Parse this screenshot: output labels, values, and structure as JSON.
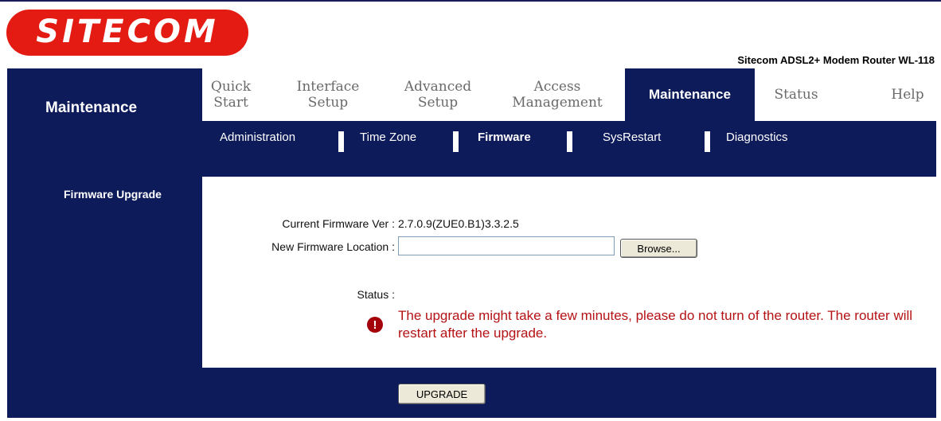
{
  "brand": {
    "logo_text": "SITECOM",
    "model": "Sitecom ADSL2+ Modem Router WL-118",
    "logo_color": "#e41b12"
  },
  "colors": {
    "navy": "#0e1b5a",
    "warning": "#b41214"
  },
  "section": {
    "title": "Maintenance",
    "sub_title": "Firmware Upgrade"
  },
  "tabs": [
    {
      "label": "Quick\nStart"
    },
    {
      "label": "Interface\nSetup"
    },
    {
      "label": "Advanced\nSetup"
    },
    {
      "label": "Access\nManagement"
    },
    {
      "label": "Maintenance",
      "active": true
    },
    {
      "label": "Status"
    },
    {
      "label": "Help"
    }
  ],
  "subtabs": [
    {
      "label": "Administration"
    },
    {
      "label": "Time Zone"
    },
    {
      "label": "Firmware",
      "active": true
    },
    {
      "label": "SysRestart"
    },
    {
      "label": "Diagnostics"
    }
  ],
  "firmware": {
    "current_label": "Current Firmware Ver :",
    "current_value": "2.7.0.9(ZUE0.B1)3.3.2.5",
    "location_label": "New Firmware Location :",
    "location_value": "",
    "browse_label": "Browse...",
    "status_label": "Status :",
    "warning_icon": "exclamation-icon",
    "warning_text": "The upgrade might take a few minutes, please do not turn of the router. The router will restart after the upgrade.",
    "upgrade_label": "UPGRADE"
  }
}
